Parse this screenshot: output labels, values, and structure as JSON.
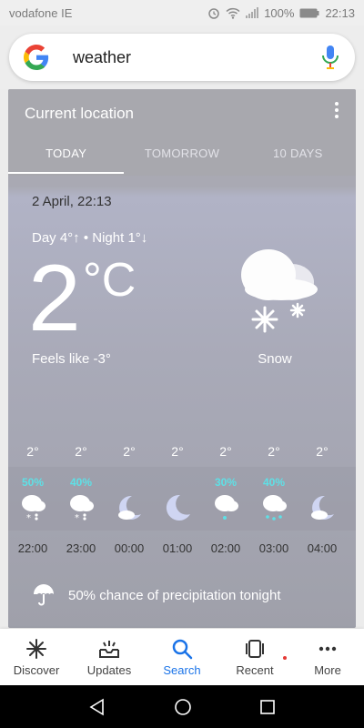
{
  "status_bar": {
    "carrier": "vodafone IE",
    "battery": "100%",
    "time": "22:13"
  },
  "search": {
    "query": "weather"
  },
  "card": {
    "title": "Current location",
    "tabs": [
      {
        "label": "TODAY",
        "active": true
      },
      {
        "label": "TOMORROW",
        "active": false
      },
      {
        "label": "10 DAYS",
        "active": false
      }
    ],
    "date": "2 April, 22:13",
    "day_night": "Day 4°↑ • Night 1°↓",
    "temperature": "2",
    "unit": "°C",
    "feels_like": "Feels like -3°",
    "condition": "Snow",
    "condition_icon": "cloud-snow-icon"
  },
  "hourly": [
    {
      "temp": "2°",
      "precip": "50%",
      "time": "22:00",
      "icon": "snow-cloud-icon"
    },
    {
      "temp": "2°",
      "precip": "40%",
      "time": "23:00",
      "icon": "snow-cloud-icon"
    },
    {
      "temp": "2°",
      "precip": "",
      "time": "00:00",
      "icon": "moon-cloud-icon"
    },
    {
      "temp": "2°",
      "precip": "",
      "time": "01:00",
      "icon": "moon-icon"
    },
    {
      "temp": "2°",
      "precip": "30%",
      "time": "02:00",
      "icon": "rain-cloud-icon"
    },
    {
      "temp": "2°",
      "precip": "40%",
      "time": "03:00",
      "icon": "rain-cloud-icon"
    },
    {
      "temp": "2°",
      "precip": "",
      "time": "04:00",
      "icon": "moon-cloud-icon"
    }
  ],
  "precip_note": "50% chance of precipitation tonight",
  "bottom_nav": [
    {
      "label": "Discover",
      "icon": "discover-icon",
      "active": false
    },
    {
      "label": "Updates",
      "icon": "updates-icon",
      "active": false
    },
    {
      "label": "Search",
      "icon": "search-icon",
      "active": true
    },
    {
      "label": "Recent",
      "icon": "recent-icon",
      "active": false
    },
    {
      "label": "More",
      "icon": "more-icon",
      "active": false
    }
  ],
  "colors": {
    "accent": "#1a73e8",
    "precip": "#5ee0e6"
  }
}
